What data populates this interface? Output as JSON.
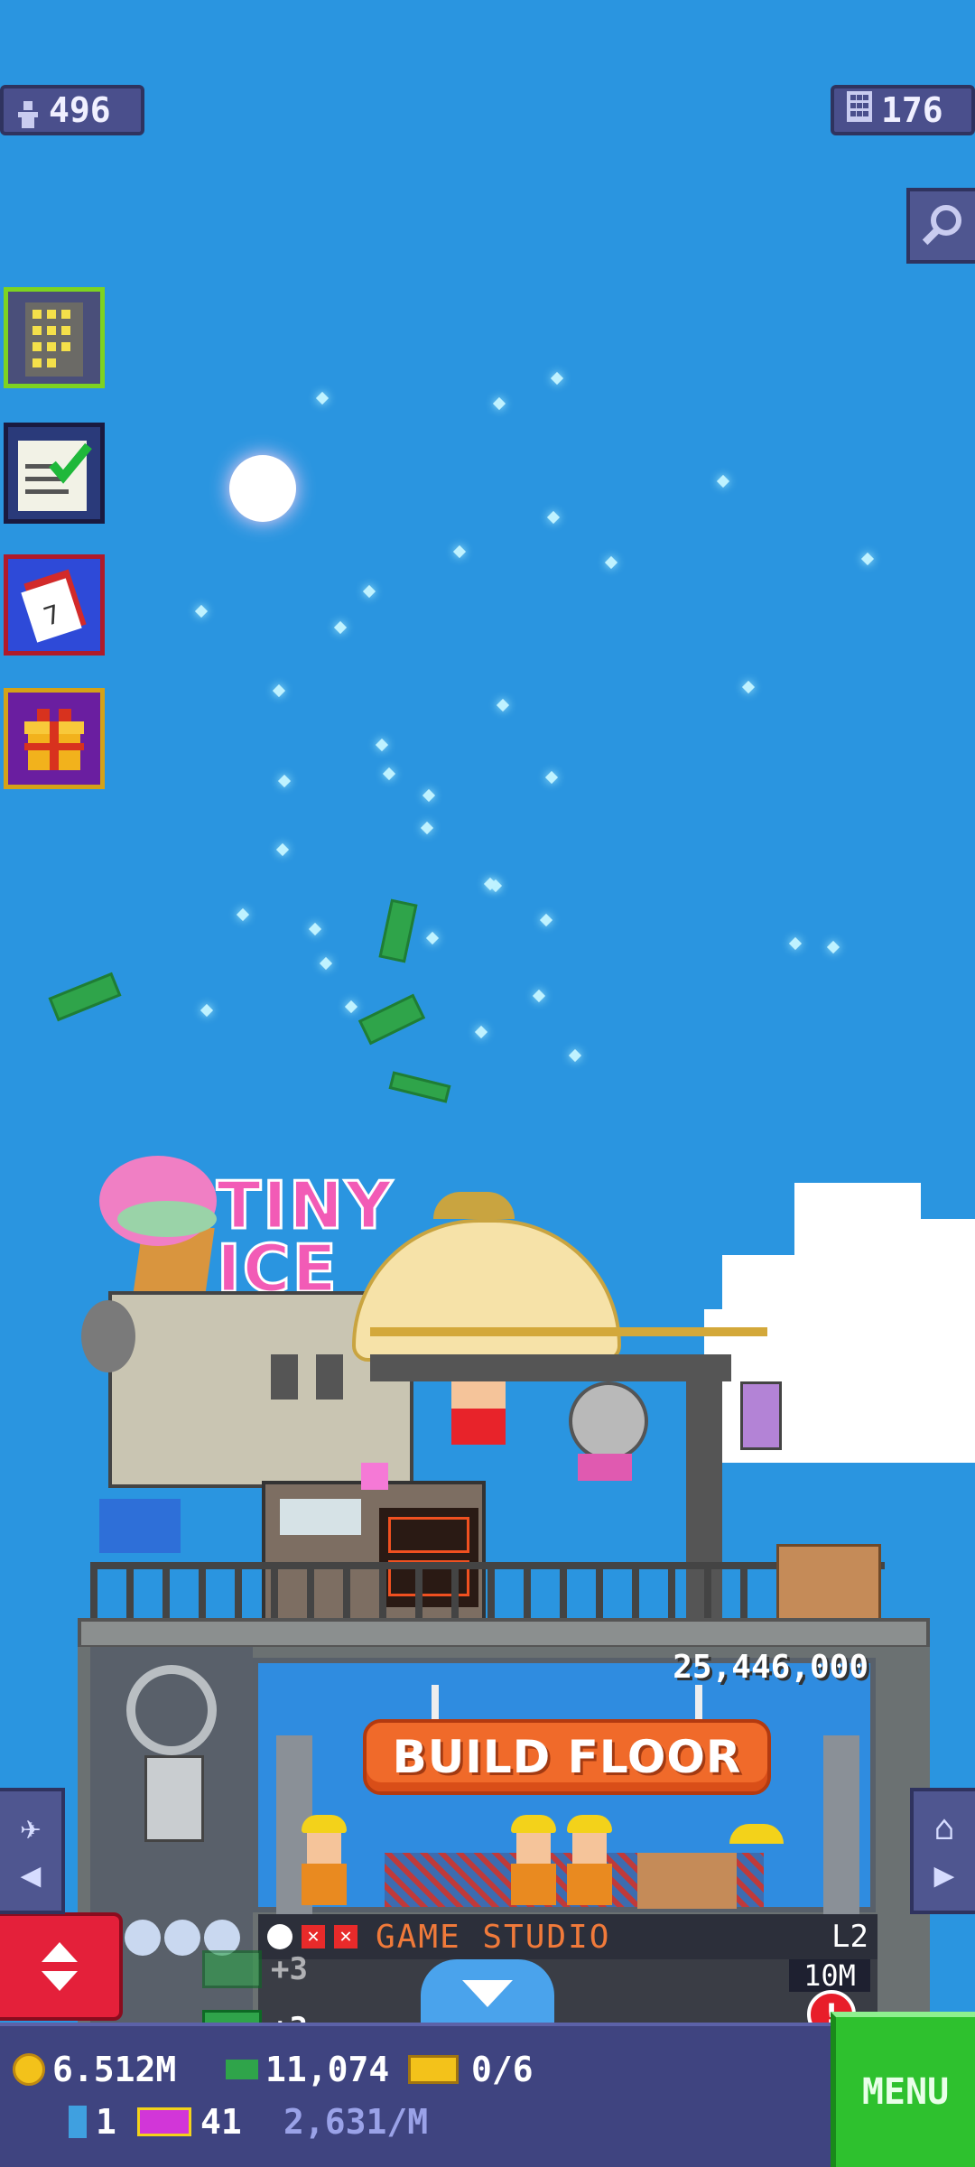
{
  "top_stats": {
    "population": "496",
    "floors": "176"
  },
  "icons": {
    "population": "person-icon",
    "floors": "building-grid-icon",
    "search": "magnifier-icon",
    "tower_menu": "building-icon",
    "missions": "checklist-icon",
    "calendar": "calendar-icon",
    "gift": "gift-icon"
  },
  "tower": {
    "sign_text": "TINY ICE",
    "build_cost": "25,446,000",
    "build_button": "BUILD FLOOR",
    "floor_name": "GAME STUDIO",
    "floor_level": "L2",
    "floor_value": "10M",
    "alert": "!"
  },
  "bux_floaters": [
    "+3",
    "+3",
    "+3"
  ],
  "bottom_bar": {
    "coins": "6.512M",
    "bux": "11,074",
    "vip_tickets": "0/6",
    "bitizens": "1",
    "tickets": "41",
    "income_rate": "2,631/M",
    "menu_label": "MENU"
  },
  "colors": {
    "sky": "#2a95e0",
    "build_button": "#f06a2a",
    "menu": "#2ec12e",
    "elevator": "#e4203a",
    "bar": "#3f4480"
  }
}
